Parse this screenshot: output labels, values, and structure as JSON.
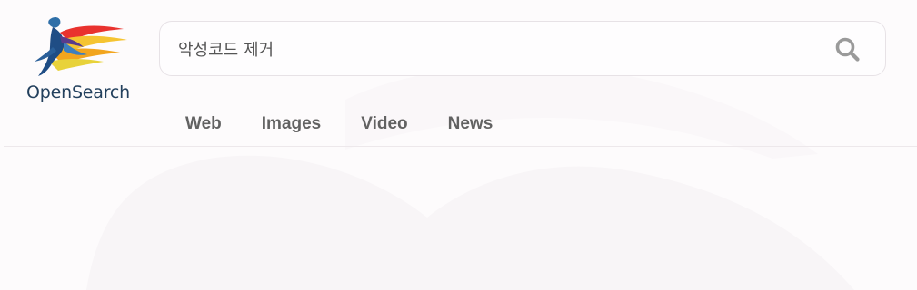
{
  "logo": {
    "text": "OpenSearch"
  },
  "search": {
    "value": "악성코드 제거",
    "icon": "search-icon"
  },
  "tabs": [
    {
      "label": "Web"
    },
    {
      "label": "Images"
    },
    {
      "label": "Video"
    },
    {
      "label": "News"
    }
  ],
  "colors": {
    "background": "#fdfbfc",
    "tab_text": "#626262",
    "logo_text": "#23405d",
    "search_icon": "#9a9a9a",
    "border": "#e7e2e6"
  }
}
